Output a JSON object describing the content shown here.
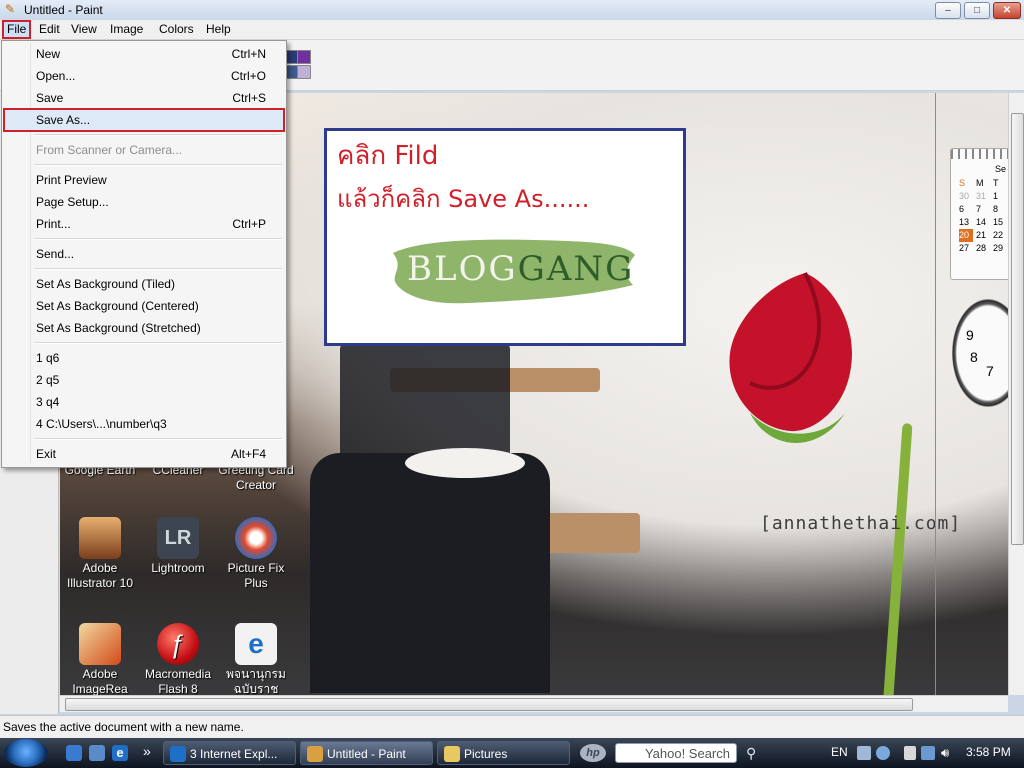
{
  "window": {
    "title": "Untitled - Paint",
    "controls": {
      "minimize": "–",
      "maximize": "□",
      "close": "✕"
    }
  },
  "menubar": {
    "items": [
      "File",
      "Edit",
      "View",
      "Image",
      "Colors",
      "Help"
    ]
  },
  "file_menu": {
    "groups": [
      [
        {
          "label": "New",
          "shortcut": "Ctrl+N"
        },
        {
          "label": "Open...",
          "shortcut": "Ctrl+O"
        },
        {
          "label": "Save",
          "shortcut": "Ctrl+S"
        },
        {
          "label": "Save As...",
          "shortcut": ""
        }
      ],
      [
        {
          "label": "From Scanner or Camera...",
          "shortcut": ""
        }
      ],
      [
        {
          "label": "Print Preview",
          "shortcut": ""
        },
        {
          "label": "Page Setup...",
          "shortcut": ""
        },
        {
          "label": "Print...",
          "shortcut": "Ctrl+P"
        }
      ],
      [
        {
          "label": "Send...",
          "shortcut": ""
        }
      ],
      [
        {
          "label": "Set As Background (Tiled)",
          "shortcut": ""
        },
        {
          "label": "Set As Background (Centered)",
          "shortcut": ""
        },
        {
          "label": "Set As Background (Stretched)",
          "shortcut": ""
        }
      ],
      [
        {
          "label": "1 q6",
          "shortcut": ""
        },
        {
          "label": "2 q5",
          "shortcut": ""
        },
        {
          "label": "3 q4",
          "shortcut": ""
        },
        {
          "label": "4 C:\\Users\\...\\number\\q3",
          "shortcut": ""
        }
      ],
      [
        {
          "label": "Exit",
          "shortcut": "Alt+F4"
        }
      ]
    ],
    "highlighted": "Save As...",
    "disabled": [
      "From Scanner or Camera..."
    ]
  },
  "annotation": {
    "line1": "คลิก Fild",
    "line2": "แล้วก็คลิก Save As......",
    "logo_part1": "BLOG",
    "logo_part2": "GANG"
  },
  "canvas": {
    "watermark": "[annathethai.com]",
    "desktop_icons_partial": [
      "Google Earth",
      "CCleaner",
      "Greeting Card",
      "Creator"
    ],
    "desktop_icons": [
      {
        "line1": "Adobe",
        "line2": "Illustrator 10"
      },
      {
        "line1": "Lightroom",
        "line2": "",
        "badge": "LR"
      },
      {
        "line1": "Picture Fix",
        "line2": "Plus"
      },
      {
        "line1": "Adobe",
        "line2": "ImageRea"
      },
      {
        "line1": "Macromedia",
        "line2": "Flash 8"
      },
      {
        "line1": "พจนานุกรม",
        "line2": "ฉบับราชบัณฑิต"
      }
    ],
    "calendar": {
      "month_label": "Se",
      "day_headers": [
        "S",
        "M",
        "T"
      ],
      "rows": [
        [
          "30",
          "31",
          "1"
        ],
        [
          "6",
          "7",
          "8"
        ],
        [
          "13",
          "14",
          "15"
        ],
        [
          "20",
          "21",
          "22"
        ],
        [
          "27",
          "28",
          "29"
        ]
      ],
      "today": "20"
    },
    "clock_numerals": [
      "9",
      "8",
      "7"
    ]
  },
  "statusbar": {
    "text": "Saves the active document with a new name."
  },
  "taskbar": {
    "tasks": [
      {
        "label": "3 Internet Expl...",
        "active": false
      },
      {
        "label": "Untitled - Paint",
        "active": true
      },
      {
        "label": "Pictures",
        "active": false
      }
    ],
    "search_placeholder": "Yahoo! Search",
    "tray": {
      "language": "EN",
      "time": "3:58 PM"
    },
    "more": "»"
  },
  "colors": {
    "accent_highlight": "#d0202a",
    "annotation_text": "#d0212a",
    "annotation_border": "#2e3a8c",
    "logo_green": "#8fb56b",
    "logo_dark_green": "#2f5d2a"
  }
}
